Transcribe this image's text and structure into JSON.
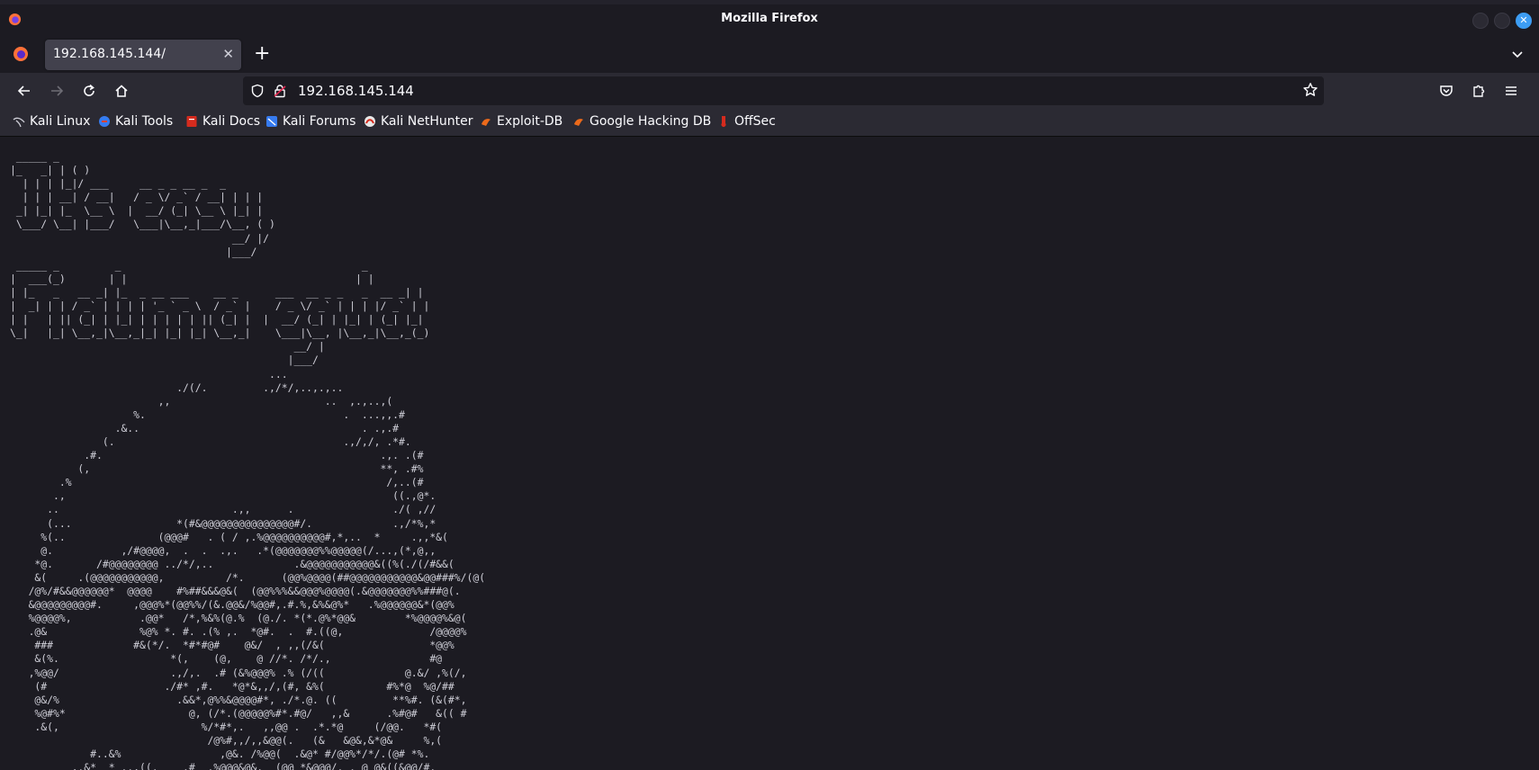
{
  "window": {
    "title": "Mozilla Firefox"
  },
  "tab": {
    "label": "192.168.145.144/"
  },
  "urlbar": {
    "url": "192.168.145.144"
  },
  "bookmarks": [
    {
      "label": "Kali Linux",
      "icon": "kali-dragon-icon"
    },
    {
      "label": "Kali Tools",
      "icon": "kali-tools-icon"
    },
    {
      "label": "Kali Docs",
      "icon": "kali-docs-icon"
    },
    {
      "label": "Kali Forums",
      "icon": "kali-forums-icon"
    },
    {
      "label": "Kali NetHunter",
      "icon": "nethunter-icon"
    },
    {
      "label": "Exploit-DB",
      "icon": "exploit-db-icon"
    },
    {
      "label": "Google Hacking DB",
      "icon": "ghdb-icon"
    },
    {
      "label": "OffSec",
      "icon": "offsec-icon"
    }
  ],
  "page": {
    "ascii_art": " _____ _\n|_   _| | ( )\n  | | | |_|/ ___     __ _ _ __ _  _\n  | | | __| / __|   / _ \\/ _` / __| | | |\n _| |_| |_  \\__ \\  |  __/ (_| \\__ \\ |_| |\n \\___/ \\__| |___/   \\___|\\__,_|___/\\__, ( )\n                                    __/ |/\n                                   |___/\n _____ _         _                                       _\n|  ___(_)       | |                                     | |\n| |_   _   __ _| |_  _ __ ___    __ _      ___  __ _ _   _  __ _| |\n|  _| | | / _` | | | | '_ ` _ \\  / _` |    / _ \\/ _` | | | |/ _` | |\n| |   | || (_| | |_| | | | | | || (_| |  |  __/ (_| | |_| | (_| |_|\n\\_|   |_| \\__,_|\\__,_|_| |_| |_| \\__,_|    \\___|\\__, |\\__,_|\\__,_(_)\n                                              __/ |\n                                             |___/\n                                          ...\n                           ./(/.         .,/*/,..,.,..\n                        ,,                         ..  ,.,..,(\n                    %.                                .  ...,,.#\n                 .&..                                    . .,.#\n               (.                                     .,/,/, .*#.\n            .#.                                             .,. .(#\n           (,                                               **, .#%\n        .%                                                   /,..(#\n       .,                                                     ((.,@*.\n      ..                            .,,      .                ./( ,//\n      (...                 *(#&@@@@@@@@@@@@@@@#/.             .,/*%,*\n     %(..               (@@@#   . ( / ,.%@@@@@@@@@@#,*,..  *     .,,*&(\n     @.           ,/#@@@@,  .  .  .,.   .*(@@@@@@@%%@@@@@(/...,(*,@,,\n    *@.       /#@@@@@@@@ ../*/,..             .&@@@@@@@@@@@&((%(./(/#&&(\n    &(     .(@@@@@@@@@@@,          /*.      (@@%@@@@(##@@@@@@@@@@@&@@###%/(@(\n   /@%/#&&@@@@@@*  @@@@    #%##&&&@&(  (@@%%%&&@@@%@@@@(.&@@@@@@@%%###@(.\n   &@@@@@@@@@#.     ,@@@%*(@@%%/(&.@@&/%@@#,.#.%,&%&@%*   .%@@@@@@&*(@@%\n   %@@@@%,           .@@*   /*,%&%(@.%  (@./. *(*.@%*@@&        *%@@@@%&@(\n   .@&               %@% *. #. .(% ,.  *@#.  .  #.((@,              /@@@@%\n    ###             #&(*/.  *#*#@#    @&/  , ,,(/&(                 *@@%\n    &(%.                  *(,    (@,    @ //*. /*/.,                #@\n   ,%@@/                  .,/,.  .# (&%@@@% .% (/((             @.&/ ,%(/,\n    (#                   ./#* ,#.   *@*&,,/,(#, &%(          #%*@  %@/##\n    @&/%                   .&&*,@%%&@@@@#*, ./*.@. ((         **%#. (&(#*,\n    %@#%*                    @, (/*.(@@@@@%#*.#@/   ,,&      .%#@#   &(( #\n    .&(,                       %/*#*,.   ,,@@ .  .*.*@     (/@@.   *#(\n                                /@%#,,/,,&@@(.   (&   &@&,&*@&     %,(\n             #..&%                ,@&. /%@@(  .&@* #/@@%*/*/.(@# *%.\n          ,.&*  * ..,((.    .#  .%@@@&@&.  (@@ *&@@@/. . @ @&((&@@/#."
  }
}
